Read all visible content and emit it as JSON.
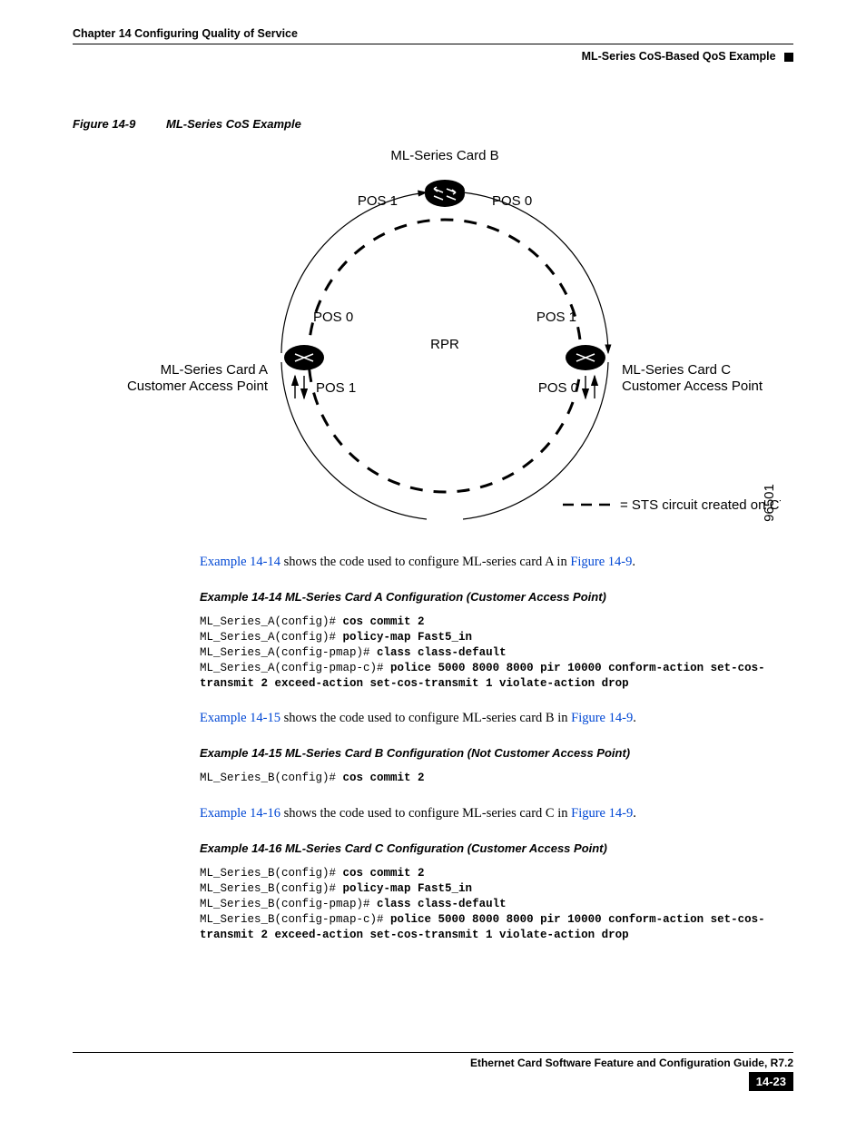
{
  "header": {
    "chapter": "Chapter 14 Configuring Quality of Service",
    "section": "ML-Series CoS-Based QoS Example"
  },
  "figure": {
    "number": "Figure 14-9",
    "title": "ML-Series CoS Example",
    "labels": {
      "cardB": "ML-Series Card B",
      "cardA1": "ML-Series Card A",
      "cardA2": "Customer Access Point",
      "cardC1": "ML-Series Card C",
      "cardC2": "Customer Access Point",
      "center": "RPR",
      "pos0": "POS 0",
      "pos1": "POS 1",
      "legend": "= STS circuit created on CTC",
      "ref": "96501"
    }
  },
  "para1": {
    "link1": "Example 14-14",
    "mid": " shows the code used to configure ML-series card A in ",
    "link2": "Figure 14-9",
    "end": "."
  },
  "ex14": {
    "title": "Example 14-14 ML-Series Card A Configuration (Customer Access Point)",
    "l1p": "ML_Series_A(config)# ",
    "l1c": "cos commit 2",
    "l2p": "ML_Series_A(config)# ",
    "l2c": "policy-map Fast5_in",
    "l3p": "ML_Series_A(config-pmap)# ",
    "l3c": "class class-default",
    "l4p": "ML_Series_A(config-pmap-c)# ",
    "l4c": "police 5000 8000 8000 pir 10000 conform-action set-cos-transmit 2 exceed-action set-cos-transmit 1 violate-action drop"
  },
  "para2": {
    "link1": "Example 14-15",
    "mid": " shows the code used to configure ML-series card B in ",
    "link2": "Figure 14-9",
    "end": "."
  },
  "ex15": {
    "title": "Example 14-15 ML-Series Card B Configuration (Not Customer Access Point)",
    "l1p": "ML_Series_B(config)# ",
    "l1c": "cos commit 2"
  },
  "para3": {
    "link1": "Example 14-16",
    "mid": " shows the code used to configure ML-series card C in ",
    "link2": "Figure 14-9",
    "end": "."
  },
  "ex16": {
    "title": "Example 14-16 ML-Series Card C Configuration (Customer Access Point)",
    "l1p": "ML_Series_B(config)# ",
    "l1c": "cos commit 2",
    "l2p": "ML_Series_B(config)# ",
    "l2c": "policy-map Fast5_in",
    "l3p": "ML_Series_B(config-pmap)# ",
    "l3c": "class class-default",
    "l4p": "ML_Series_B(config-pmap-c)# ",
    "l4c": "police 5000 8000 8000 pir 10000 conform-action set-cos-transmit 2 exceed-action set-cos-transmit 1 violate-action drop"
  },
  "footer": {
    "guide": "Ethernet Card Software Feature and Configuration Guide, R7.2",
    "page": "14-23"
  }
}
